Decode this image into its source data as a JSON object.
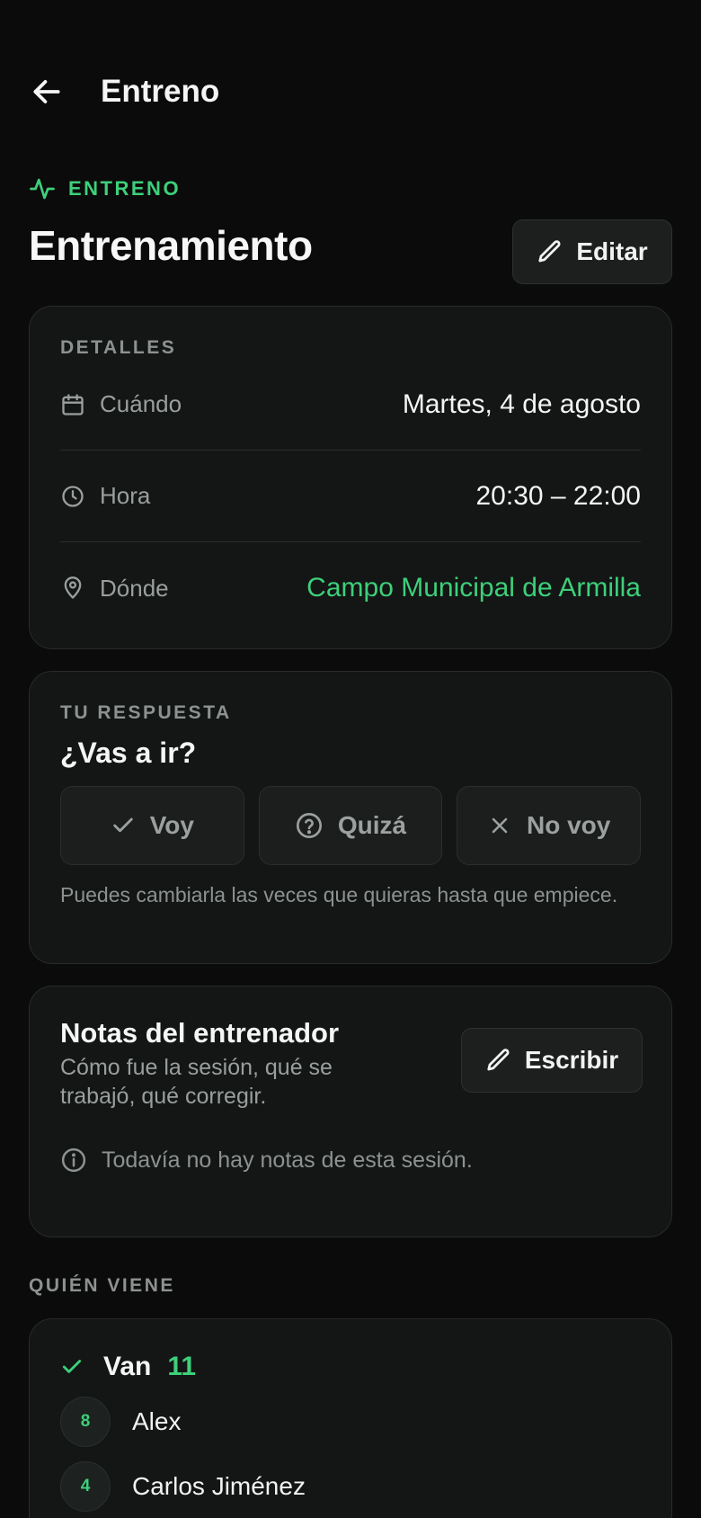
{
  "topbar": {
    "title": "Entreno"
  },
  "header": {
    "kicker": "ENTRENO",
    "title": "Entrenamiento",
    "edit_label": "Editar"
  },
  "details": {
    "label": "DETALLES",
    "rows": [
      {
        "icon": "calendar-icon",
        "label": "Cuándo",
        "value": "Martes, 4 de agosto"
      },
      {
        "icon": "clock-icon",
        "label": "Hora",
        "value": "20:30 – 22:00"
      },
      {
        "icon": "location-pin-icon",
        "label": "Dónde",
        "value": "Campo Municipal de Armilla"
      }
    ]
  },
  "response": {
    "label": "TU RESPUESTA",
    "question": "¿Vas a ir?",
    "options": [
      {
        "icon": "check-icon",
        "label": "Voy"
      },
      {
        "icon": "question-circle-icon",
        "label": "Quizá"
      },
      {
        "icon": "x-icon",
        "label": "No voy"
      }
    ],
    "hint": "Puedes cambiarla las veces que quieras hasta que empiece."
  },
  "notes": {
    "title": "Notas del entrenador",
    "subtitle": "Cómo fue la sesión, qué se trabajó, qué corregir.",
    "write_label": "Escribir",
    "empty": "Todavía no hay notas de esta sesión."
  },
  "attendance": {
    "label": "QUIÉN VIENE",
    "group_title": "Van",
    "group_count": "11",
    "people": [
      {
        "number": "8",
        "name": "Alex"
      },
      {
        "number": "4",
        "name": "Carlos Jiménez"
      }
    ]
  },
  "colors": {
    "accent": "#3ecf7a",
    "background": "#0b0b0b",
    "card": "#131615"
  }
}
